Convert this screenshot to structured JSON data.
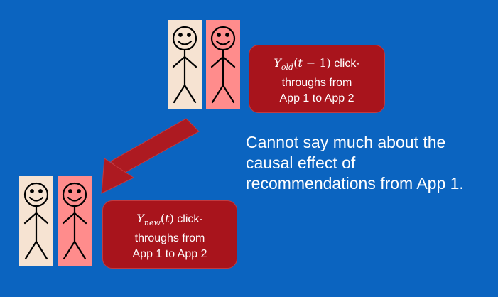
{
  "colors": {
    "background": "#0b64c0",
    "callout_fill": "#a8141c",
    "arrow": "#ad1a21",
    "figure_beige": "#f6e3d2",
    "figure_pink": "#ff8c8c"
  },
  "top_group": {
    "callout": {
      "math_var": "Y",
      "math_sub": "old",
      "math_arg_open": "(",
      "math_arg_var": "t",
      "math_arg_rest": " − 1)",
      "line1_tail": " click-",
      "line2": "throughs from",
      "line3": "App 1 to App 2"
    }
  },
  "bottom_group": {
    "callout": {
      "math_var": "Y",
      "math_sub": "new",
      "math_arg_open": "(",
      "math_arg_var": "t",
      "math_arg_rest": ")",
      "line1_tail": " click-",
      "line2": "throughs from",
      "line3": "App 1 to App 2"
    }
  },
  "statement": {
    "line1": "Cannot say much about the",
    "line2": "causal effect of",
    "line3": "recommendations from App 1."
  }
}
